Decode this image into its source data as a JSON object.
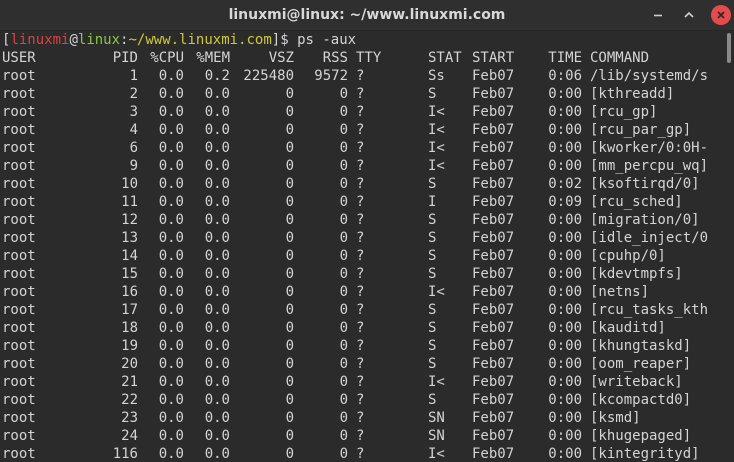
{
  "window": {
    "title": "linuxmi@linux: ~/www.linuxmi.com"
  },
  "icons": {
    "minimize": "minimize-icon",
    "maximize": "maximize-icon",
    "close": "close-icon"
  },
  "colors": {
    "background": "#2b2b2b",
    "prompt_user": "#e04040",
    "prompt_host": "#87c93d",
    "prompt_path": "#cfc73a",
    "close_button": "#e64b4b"
  },
  "prompt": {
    "open": "[",
    "user": "linuxmi",
    "at": "@",
    "host": "linux",
    "colon": ":",
    "path": "~/www.linuxmi.com",
    "close": "]$ ",
    "command": "ps -aux"
  },
  "header": {
    "user": "USER",
    "pid": "PID",
    "cpu": "%CPU",
    "mem": "%MEM",
    "vsz": "VSZ",
    "rss": "RSS",
    "tty": "TTY",
    "stat": "STAT",
    "start": "START",
    "time": "TIME",
    "command": "COMMAND"
  },
  "processes": [
    {
      "user": "root",
      "pid": "1",
      "cpu": "0.0",
      "mem": "0.2",
      "vsz": "225480",
      "rss": "9572",
      "tty": "?",
      "stat": "Ss",
      "start": "Feb07",
      "time": "0:06",
      "command": "/lib/systemd/s"
    },
    {
      "user": "root",
      "pid": "2",
      "cpu": "0.0",
      "mem": "0.0",
      "vsz": "0",
      "rss": "0",
      "tty": "?",
      "stat": "S",
      "start": "Feb07",
      "time": "0:00",
      "command": "[kthreadd]"
    },
    {
      "user": "root",
      "pid": "3",
      "cpu": "0.0",
      "mem": "0.0",
      "vsz": "0",
      "rss": "0",
      "tty": "?",
      "stat": "I<",
      "start": "Feb07",
      "time": "0:00",
      "command": "[rcu_gp]"
    },
    {
      "user": "root",
      "pid": "4",
      "cpu": "0.0",
      "mem": "0.0",
      "vsz": "0",
      "rss": "0",
      "tty": "?",
      "stat": "I<",
      "start": "Feb07",
      "time": "0:00",
      "command": "[rcu_par_gp]"
    },
    {
      "user": "root",
      "pid": "6",
      "cpu": "0.0",
      "mem": "0.0",
      "vsz": "0",
      "rss": "0",
      "tty": "?",
      "stat": "I<",
      "start": "Feb07",
      "time": "0:00",
      "command": "[kworker/0:0H-"
    },
    {
      "user": "root",
      "pid": "9",
      "cpu": "0.0",
      "mem": "0.0",
      "vsz": "0",
      "rss": "0",
      "tty": "?",
      "stat": "I<",
      "start": "Feb07",
      "time": "0:00",
      "command": "[mm_percpu_wq]"
    },
    {
      "user": "root",
      "pid": "10",
      "cpu": "0.0",
      "mem": "0.0",
      "vsz": "0",
      "rss": "0",
      "tty": "?",
      "stat": "S",
      "start": "Feb07",
      "time": "0:02",
      "command": "[ksoftirqd/0]"
    },
    {
      "user": "root",
      "pid": "11",
      "cpu": "0.0",
      "mem": "0.0",
      "vsz": "0",
      "rss": "0",
      "tty": "?",
      "stat": "I",
      "start": "Feb07",
      "time": "0:09",
      "command": "[rcu_sched]"
    },
    {
      "user": "root",
      "pid": "12",
      "cpu": "0.0",
      "mem": "0.0",
      "vsz": "0",
      "rss": "0",
      "tty": "?",
      "stat": "S",
      "start": "Feb07",
      "time": "0:00",
      "command": "[migration/0]"
    },
    {
      "user": "root",
      "pid": "13",
      "cpu": "0.0",
      "mem": "0.0",
      "vsz": "0",
      "rss": "0",
      "tty": "?",
      "stat": "S",
      "start": "Feb07",
      "time": "0:00",
      "command": "[idle_inject/0"
    },
    {
      "user": "root",
      "pid": "14",
      "cpu": "0.0",
      "mem": "0.0",
      "vsz": "0",
      "rss": "0",
      "tty": "?",
      "stat": "S",
      "start": "Feb07",
      "time": "0:00",
      "command": "[cpuhp/0]"
    },
    {
      "user": "root",
      "pid": "15",
      "cpu": "0.0",
      "mem": "0.0",
      "vsz": "0",
      "rss": "0",
      "tty": "?",
      "stat": "S",
      "start": "Feb07",
      "time": "0:00",
      "command": "[kdevtmpfs]"
    },
    {
      "user": "root",
      "pid": "16",
      "cpu": "0.0",
      "mem": "0.0",
      "vsz": "0",
      "rss": "0",
      "tty": "?",
      "stat": "I<",
      "start": "Feb07",
      "time": "0:00",
      "command": "[netns]"
    },
    {
      "user": "root",
      "pid": "17",
      "cpu": "0.0",
      "mem": "0.0",
      "vsz": "0",
      "rss": "0",
      "tty": "?",
      "stat": "S",
      "start": "Feb07",
      "time": "0:00",
      "command": "[rcu_tasks_kth"
    },
    {
      "user": "root",
      "pid": "18",
      "cpu": "0.0",
      "mem": "0.0",
      "vsz": "0",
      "rss": "0",
      "tty": "?",
      "stat": "S",
      "start": "Feb07",
      "time": "0:00",
      "command": "[kauditd]"
    },
    {
      "user": "root",
      "pid": "19",
      "cpu": "0.0",
      "mem": "0.0",
      "vsz": "0",
      "rss": "0",
      "tty": "?",
      "stat": "S",
      "start": "Feb07",
      "time": "0:00",
      "command": "[khungtaskd]"
    },
    {
      "user": "root",
      "pid": "20",
      "cpu": "0.0",
      "mem": "0.0",
      "vsz": "0",
      "rss": "0",
      "tty": "?",
      "stat": "S",
      "start": "Feb07",
      "time": "0:00",
      "command": "[oom_reaper]"
    },
    {
      "user": "root",
      "pid": "21",
      "cpu": "0.0",
      "mem": "0.0",
      "vsz": "0",
      "rss": "0",
      "tty": "?",
      "stat": "I<",
      "start": "Feb07",
      "time": "0:00",
      "command": "[writeback]"
    },
    {
      "user": "root",
      "pid": "22",
      "cpu": "0.0",
      "mem": "0.0",
      "vsz": "0",
      "rss": "0",
      "tty": "?",
      "stat": "S",
      "start": "Feb07",
      "time": "0:00",
      "command": "[kcompactd0]"
    },
    {
      "user": "root",
      "pid": "23",
      "cpu": "0.0",
      "mem": "0.0",
      "vsz": "0",
      "rss": "0",
      "tty": "?",
      "stat": "SN",
      "start": "Feb07",
      "time": "0:00",
      "command": "[ksmd]"
    },
    {
      "user": "root",
      "pid": "24",
      "cpu": "0.0",
      "mem": "0.0",
      "vsz": "0",
      "rss": "0",
      "tty": "?",
      "stat": "SN",
      "start": "Feb07",
      "time": "0:00",
      "command": "[khugepaged]"
    },
    {
      "user": "root",
      "pid": "116",
      "cpu": "0.0",
      "mem": "0.0",
      "vsz": "0",
      "rss": "0",
      "tty": "?",
      "stat": "I<",
      "start": "Feb07",
      "time": "0:00",
      "command": "[kintegrityd]"
    }
  ]
}
